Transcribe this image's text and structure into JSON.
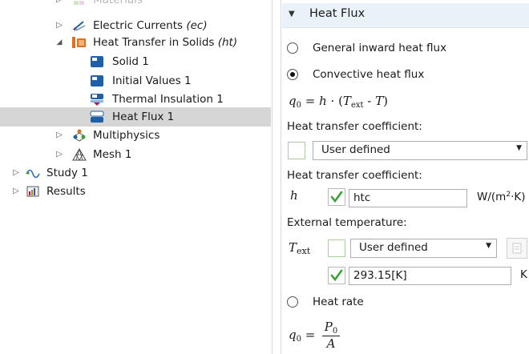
{
  "tree": {
    "items": [
      {
        "label": "Materials",
        "italic_suffix": ""
      },
      {
        "label": "Electric Currents ",
        "italic_suffix": "(ec)"
      },
      {
        "label": "Heat Transfer in Solids ",
        "italic_suffix": "(ht)"
      },
      {
        "label": "Solid 1",
        "italic_suffix": ""
      },
      {
        "label": "Initial Values 1",
        "italic_suffix": ""
      },
      {
        "label": "Thermal Insulation 1",
        "italic_suffix": ""
      },
      {
        "label": "Heat Flux 1",
        "italic_suffix": ""
      },
      {
        "label": "Multiphysics",
        "italic_suffix": ""
      },
      {
        "label": "Mesh 1",
        "italic_suffix": ""
      },
      {
        "label": "Study 1",
        "italic_suffix": ""
      },
      {
        "label": "Results",
        "italic_suffix": ""
      }
    ],
    "selected_item": "Heat Flux 1"
  },
  "settings": {
    "section_title": "Heat Flux",
    "radio_general": "General inward heat flux",
    "radio_convective": "Convective heat flux",
    "radio_heat_rate": "Heat rate",
    "selected_option": "Convective heat flux",
    "formula_convective": {
      "lhs": "q",
      "lhs_sub": "0",
      "eq": " = ",
      "h": "h",
      "dot": " · (",
      "t": "T",
      "t_sub": "ext",
      "minus": " - ",
      "t2": "T",
      "close": ")"
    },
    "htc_type_label": "Heat transfer coefficient:",
    "htc_type_value": "User defined",
    "htc_label": "Heat transfer coefficient:",
    "htc_symbol": "h",
    "htc_value": "htc",
    "htc_unit": "W/(m",
    "htc_unit_sup": "2",
    "htc_unit_tail": "·K)",
    "ext_temp_label": "External temperature:",
    "ext_temp_symbol": "T",
    "ext_temp_sub": "ext",
    "ext_temp_type_value": "User defined",
    "ext_temp_value": "293.15[K]",
    "ext_temp_unit": "K",
    "formula_rate": {
      "lhs": "q",
      "lhs_sub": "0",
      "eq": " = ",
      "num": "P",
      "num_sub": "0",
      "den": "A"
    }
  },
  "colors": {
    "selection": "#d6d6d6",
    "section_header_bg": "#eaf1f8",
    "check_green": "#3aa335",
    "icon_blue": "#1f5fa8",
    "icon_orange": "#e0701b"
  },
  "icons": {
    "expand_collapsed": "triangle-right-icon",
    "expand_open": "triangle-down-icon",
    "physics_node": "heat-transfer-icon",
    "domain_node": "domain-feature-icon",
    "boundary_node": "boundary-feature-icon",
    "section_toggle": "chevron-down-icon",
    "check": "checkmark-icon"
  }
}
